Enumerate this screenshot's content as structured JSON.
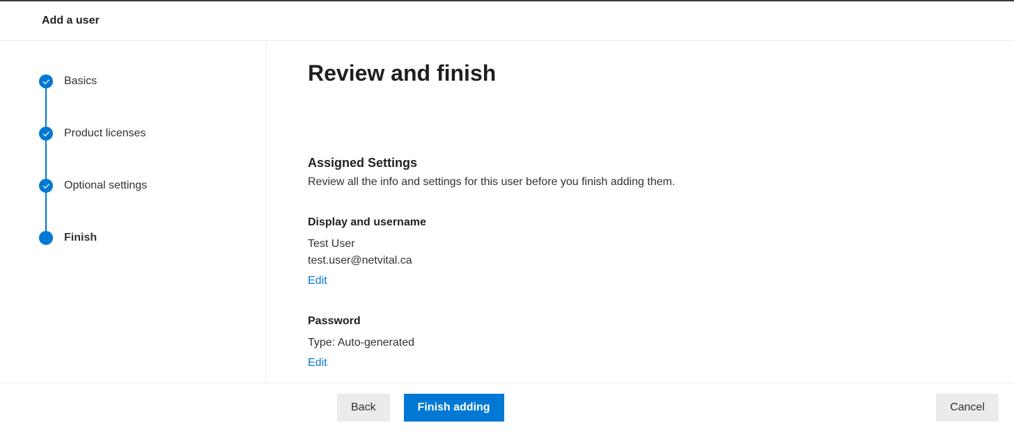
{
  "header": {
    "title": "Add a user"
  },
  "steps": [
    {
      "label": "Basics",
      "state": "done"
    },
    {
      "label": "Product licenses",
      "state": "done"
    },
    {
      "label": "Optional settings",
      "state": "done"
    },
    {
      "label": "Finish",
      "state": "current"
    }
  ],
  "main": {
    "heading": "Review and finish",
    "assigned": {
      "title": "Assigned Settings",
      "desc": "Review all the info and settings for this user before you finish adding them."
    },
    "displayUsername": {
      "title": "Display and username",
      "name": "Test User",
      "email": "test.user@netvital.ca",
      "edit": "Edit"
    },
    "password": {
      "title": "Password",
      "type_line": "Type: Auto-generated",
      "edit": "Edit"
    }
  },
  "footer": {
    "back": "Back",
    "finish": "Finish adding",
    "cancel": "Cancel"
  }
}
